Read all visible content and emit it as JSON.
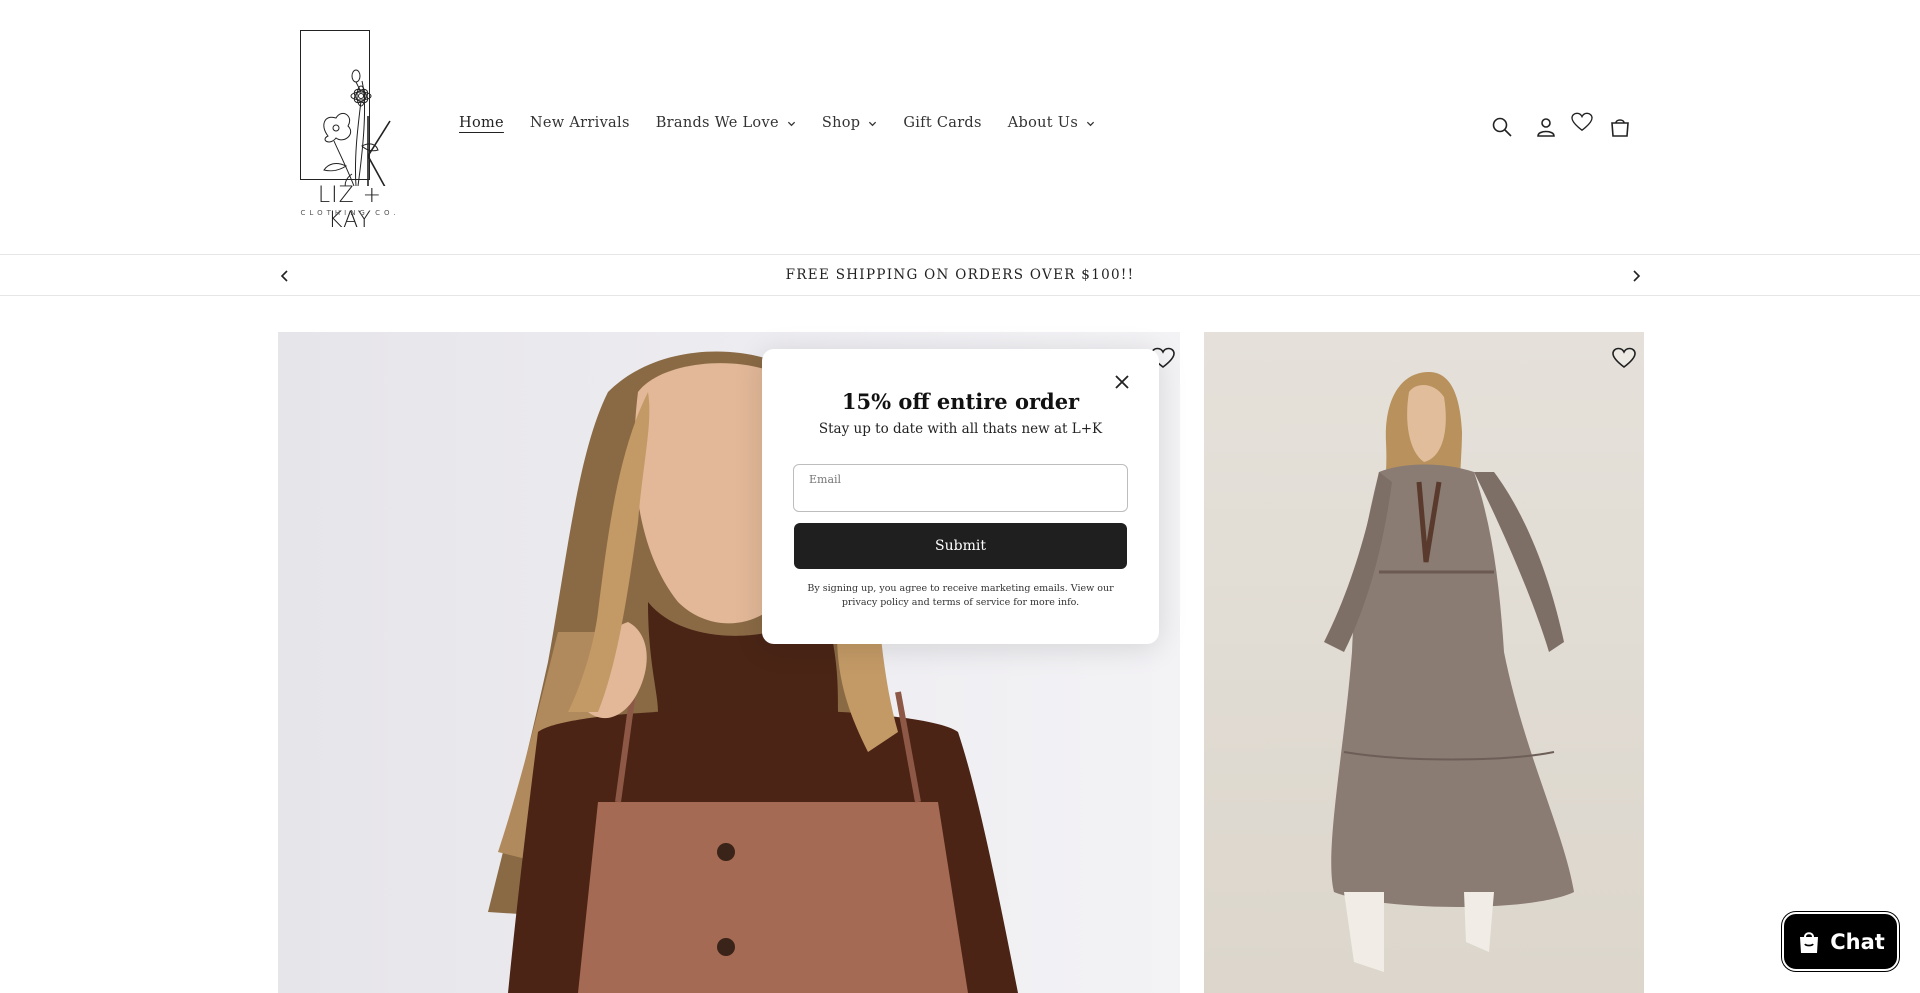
{
  "brand": {
    "wordmark": "LIZ + KAY",
    "subline": "CLOTHING CO."
  },
  "nav": {
    "items": [
      {
        "label": "Home",
        "active": true,
        "dropdown": false
      },
      {
        "label": "New Arrivals",
        "active": false,
        "dropdown": false
      },
      {
        "label": "Brands We Love",
        "active": false,
        "dropdown": true
      },
      {
        "label": "Shop",
        "active": false,
        "dropdown": true
      },
      {
        "label": "Gift Cards",
        "active": false,
        "dropdown": false
      },
      {
        "label": "About Us",
        "active": false,
        "dropdown": true
      }
    ]
  },
  "header_icons": [
    "search-icon",
    "account-icon",
    "wishlist-heart-icon",
    "cart-icon"
  ],
  "announcement": {
    "text": "FREE SHIPPING ON ORDERS OVER $100!!"
  },
  "popup": {
    "title": "15% off entire order",
    "subtitle": "Stay up to date with all thats new at L+K",
    "email_label": "Email",
    "email_value": "",
    "submit_label": "Submit",
    "legal": "By signing up, you agree to receive marketing emails. View our privacy policy and terms of service for more info."
  },
  "chat": {
    "label": "Chat"
  },
  "colors": {
    "button_dark": "#1f1f1f",
    "chat_bg": "#000000",
    "text": "#222222"
  }
}
